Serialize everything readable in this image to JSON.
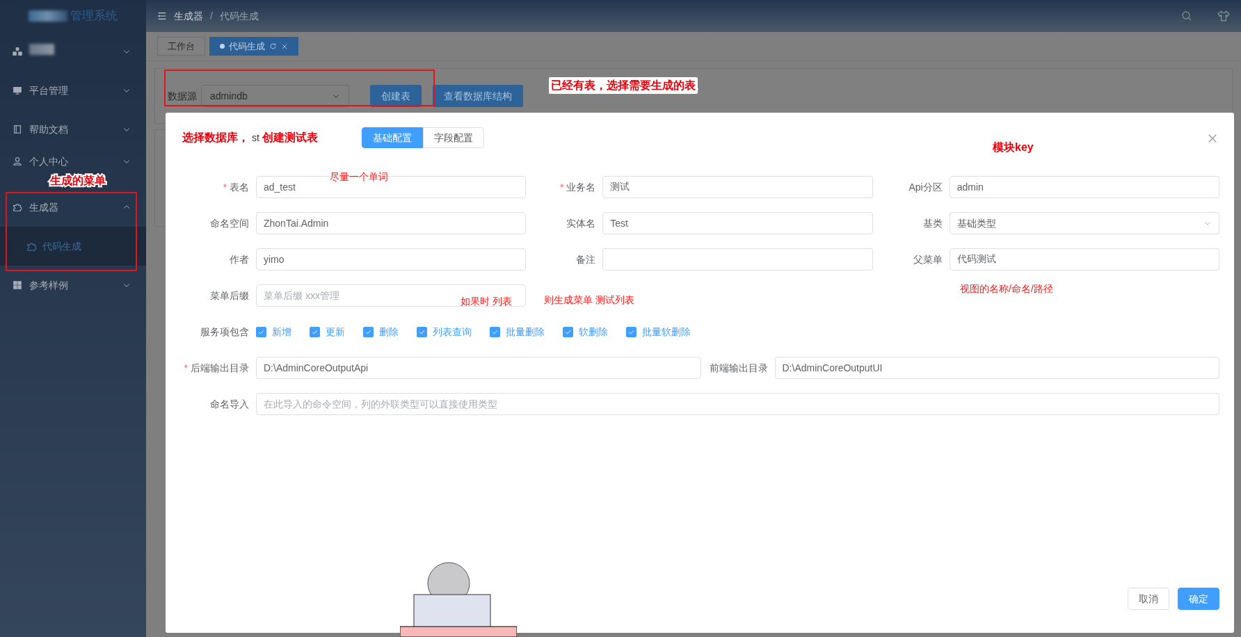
{
  "sidebar": {
    "logo_text": "管理系统",
    "items": [
      {
        "kind": "redacted",
        "expanded": false
      },
      {
        "kind": "menu",
        "label": "平台管理",
        "expanded": false
      },
      {
        "kind": "menu",
        "label": "帮助文档",
        "expanded": false
      },
      {
        "kind": "menu",
        "label": "个人中心",
        "expanded": false
      },
      {
        "kind": "menu",
        "label": "生成器",
        "expanded": true,
        "children": [
          {
            "label": "代码生成",
            "selected": true
          }
        ]
      },
      {
        "kind": "menu",
        "label": "参考样例",
        "expanded": false
      }
    ]
  },
  "header": {
    "breadcrumb": [
      "生成器",
      "代码生成"
    ],
    "breadcrumb_separator": "/"
  },
  "tabs": [
    {
      "label": "工作台",
      "selected": false
    },
    {
      "label": "代码生成",
      "selected": true
    }
  ],
  "toolbar": {
    "datasource_label": "数据源",
    "datasource_value": "admindb",
    "buttons": [
      "创建表",
      "查看数据库结构"
    ]
  },
  "dialog": {
    "title": "st",
    "required_mark": "*",
    "tabs": [
      {
        "label": "基础配置",
        "selected": true
      },
      {
        "label": "字段配置",
        "selected": false
      }
    ],
    "rows": [
      [
        {
          "label": "表名",
          "required": true,
          "kind": "input",
          "value": "ad_test"
        },
        {
          "label": "业务名",
          "required": true,
          "kind": "input",
          "value": "测试"
        },
        {
          "label": "Api分区",
          "required": false,
          "kind": "input",
          "value": "admin"
        }
      ],
      [
        {
          "label": "命名空间",
          "required": false,
          "kind": "input",
          "value": "ZhonTai.Admin"
        },
        {
          "label": "实体名",
          "required": false,
          "kind": "input",
          "value": "Test"
        },
        {
          "label": "基类",
          "required": false,
          "kind": "select",
          "value": "基础类型"
        }
      ],
      [
        {
          "label": "作者",
          "required": false,
          "kind": "input",
          "value": "yimo"
        },
        {
          "label": "备注",
          "required": false,
          "kind": "input"
        },
        {
          "label": "父菜单",
          "required": false,
          "kind": "input",
          "value": "代码测试"
        }
      ],
      [
        {
          "label": "菜单后缀",
          "required": false,
          "kind": "input",
          "placeholder": "菜单后缀 xxx管理"
        }
      ]
    ],
    "services": {
      "label": "服务项包含",
      "options": [
        {
          "label": "新增",
          "checked": true
        },
        {
          "label": "更新",
          "checked": true
        },
        {
          "label": "删除",
          "checked": true
        },
        {
          "label": "列表查询",
          "checked": true
        },
        {
          "label": "批量删除",
          "checked": true
        },
        {
          "label": "软删除",
          "checked": true
        },
        {
          "label": "批量软删除",
          "checked": true
        }
      ]
    },
    "outputs": [
      {
        "label": "后端输出目录",
        "required": true,
        "value": "D:\\AdminCoreOutputApi"
      },
      {
        "label": "前端输出目录",
        "required": false,
        "value": "D:\\AdminCoreOutputUI"
      }
    ],
    "imports": {
      "label": "命名导入",
      "placeholder": "在此导入的命令空间，列的外联类型可以直接使用类型"
    },
    "buttons": [
      {
        "label": "取消",
        "kind": "secondary"
      },
      {
        "label": "确定",
        "kind": "primary"
      }
    ]
  },
  "annotations": [
    {
      "text": "已经有表，选择需要生成的表",
      "kind": "callout"
    },
    {
      "text": "生成的菜单",
      "kind": "callout"
    },
    {
      "text": "选择数据库，",
      "kind": "callout"
    },
    {
      "text": "创建测试表",
      "kind": "callout"
    },
    {
      "text": "尽量一个单词",
      "kind": "note"
    },
    {
      "text": "模块key",
      "kind": "callout"
    },
    {
      "text": "如果时 列表",
      "kind": "note"
    },
    {
      "text": "则生成菜单  测试列表",
      "kind": "note"
    },
    {
      "text": "视图的名称/命名/路径",
      "kind": "note"
    }
  ]
}
